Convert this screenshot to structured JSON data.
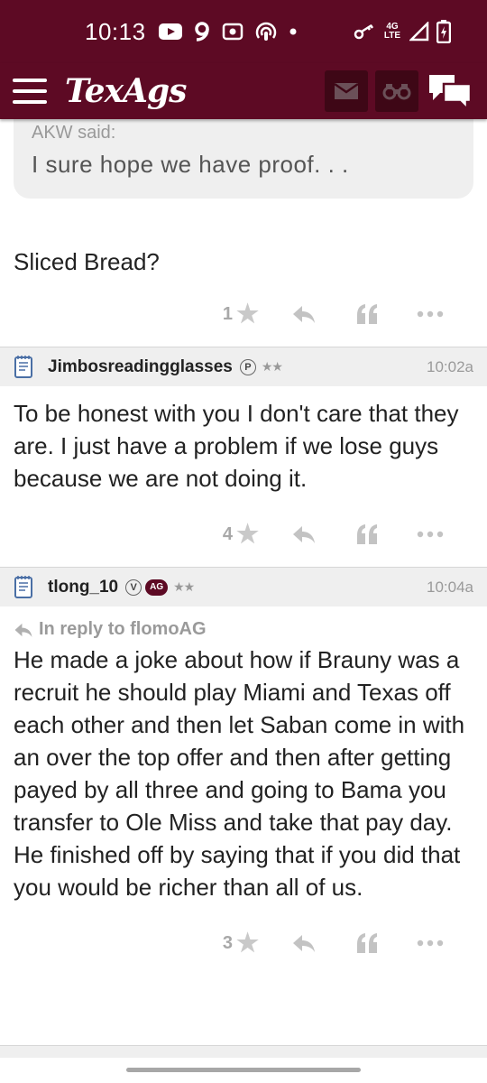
{
  "status_bar": {
    "time": "10:13",
    "network": "4G LTE",
    "left_icons": [
      "youtube-icon",
      "nine-icon",
      "radio-icon",
      "podcast-icon",
      "dot-icon"
    ],
    "right_icons": [
      "key-icon",
      "signal-icon",
      "battery-icon"
    ]
  },
  "header": {
    "logo": "TexAgs",
    "buttons": [
      "mail-icon",
      "binoculars-icon",
      "chat-icon"
    ]
  },
  "quote": {
    "author": "AKW said:",
    "text": "I sure hope we have proof. . ."
  },
  "posts": [
    {
      "body": "Sliced Bread?",
      "star_count": "1"
    },
    {
      "username": "Jimbosreadingglasses",
      "badge": "P",
      "rank": "★★",
      "time": "10:02a",
      "body": "To be honest with you I don't care that they are. I just have a problem if we lose guys because we are not doing it.",
      "star_count": "4"
    },
    {
      "username": "tlong_10",
      "badge": "V",
      "badge2": "AG",
      "rank": "★★",
      "time": "10:04a",
      "reply_to": "In reply to flomoAG",
      "body": "He made a joke about how if Brauny was a recruit he should play Miami and Texas off each other and then let Saban come in with an over the top offer and then after getting payed by all three and going to Bama you transfer to Ole Miss and take that pay day. He finished off by saying that if you did that you would be richer than all of us.",
      "star_count": "3"
    }
  ],
  "colors": {
    "brand": "#5d0a24",
    "header_button_bg": "#3e0716",
    "post_header_bg": "#efefef"
  }
}
